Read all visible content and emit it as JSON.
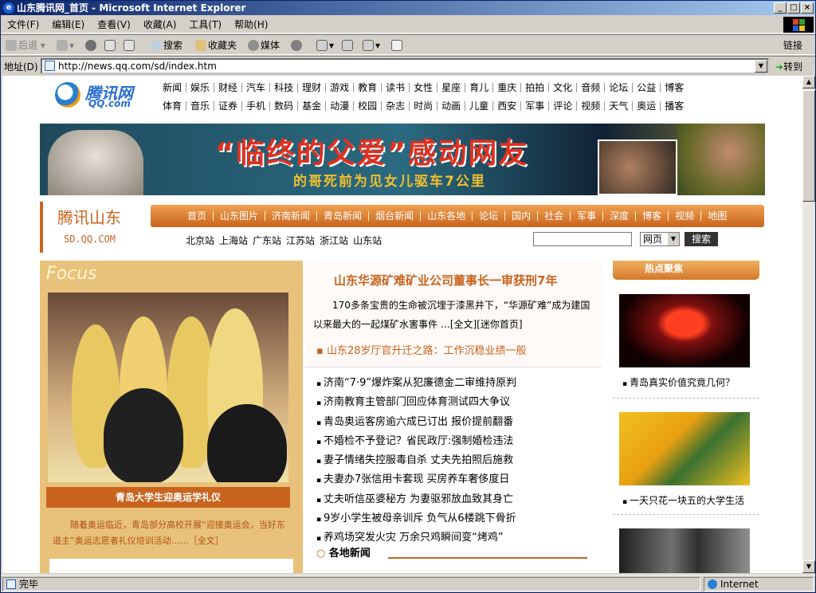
{
  "window": {
    "title": "山东腾讯网_首页 - Microsoft Internet Explorer"
  },
  "menu": [
    "文件(F)",
    "编辑(E)",
    "查看(V)",
    "收藏(A)",
    "工具(T)",
    "帮助(H)"
  ],
  "toolbar": {
    "back": "后退",
    "search": "搜索",
    "favorites": "收藏夹",
    "media": "媒体",
    "links": "链接"
  },
  "address": {
    "label": "地址(D)",
    "url": "http://news.qq.com/sd/index.htm",
    "go": "转到"
  },
  "status": {
    "text": "完毕",
    "zone": "Internet"
  },
  "site": {
    "logo_cn": "腾讯网",
    "logo_en": "QQ.com",
    "nav_row1": [
      "新闻",
      "娱乐",
      "财经",
      "汽车",
      "科技",
      "理财",
      "游戏",
      "教育",
      "读书",
      "女性",
      "星座",
      "育儿",
      "重庆",
      "拍拍",
      "文化",
      "音频",
      "论坛",
      "公益",
      "博客"
    ],
    "nav_row2": [
      "体育",
      "音乐",
      "证券",
      "手机",
      "数码",
      "基金",
      "动漫",
      "校园",
      "杂志",
      "时尚",
      "动画",
      "儿童",
      "西安",
      "军事",
      "评论",
      "视频",
      "天气",
      "奥运",
      "播客"
    ],
    "banner": {
      "headline": "“临终的父爱”感动网友",
      "sub": "的哥死前为见女儿驱车7公里"
    },
    "brand": {
      "name": "腾讯山东",
      "domain": "SD.QQ.COM"
    },
    "channels": [
      "首页",
      "山东图片",
      "济南新闻",
      "青岛新闻",
      "烟台新闻",
      "山东各地",
      "论坛",
      "国内",
      "社会",
      "军事",
      "深度",
      "博客",
      "视频",
      "地图"
    ],
    "stations": [
      "北京站",
      "上海站",
      "广东站",
      "江苏站",
      "浙江站",
      "山东站"
    ],
    "search_select": "网页",
    "search_button": "搜索",
    "focus": {
      "title": "Focus",
      "caption": "青岛大学生迎奥运学礼仪",
      "desc": "随着奥运临近，青岛部分高校开展“迎接奥运会，当好东道主”奥运志愿者礼仪培训活动……［全文］"
    },
    "lead": {
      "headline": "山东华源矿难矿业公司董事长一审获刑7年",
      "summary": "170多条宝贵的生命被沉埋于漆黑井下，“华源矿难”成为建国以来最大的一起煤矿水害事件 …[全文][迷你首页]",
      "sub": "▪ 山东28岁厅官升迁之路：工作沉稳业绩一般"
    },
    "news": [
      "济南“7·9”爆炸案从犯廉德金二审维持原判",
      "济南教育主管部门回应体育测试四大争议",
      "青岛奥运客房逾六成已订出 报价提前翻番",
      "不婚检不予登记？省民政厅:强制婚检违法",
      "妻子情绪失控服毒自杀 丈夫先拍照后施救",
      "夫妻办7张信用卡套现 买房养车奢侈度日",
      "丈夫听信巫婆秘方 为妻驱邪放血致其身亡",
      "9岁小学生被母亲训斥 负气从6楼跳下骨折",
      "养鸡场突发火灾 万余只鸡瞬间变“烤鸡”"
    ],
    "local_section": "各地新闻",
    "hot": {
      "title": "热点聚焦",
      "items": [
        "青岛真实价值究竟几何？",
        "一天只花一块五的大学生活"
      ]
    }
  },
  "colors": {
    "accent": "#c8641e",
    "title_bar": "#0a246a",
    "link_blue": "#2a6fd0"
  }
}
